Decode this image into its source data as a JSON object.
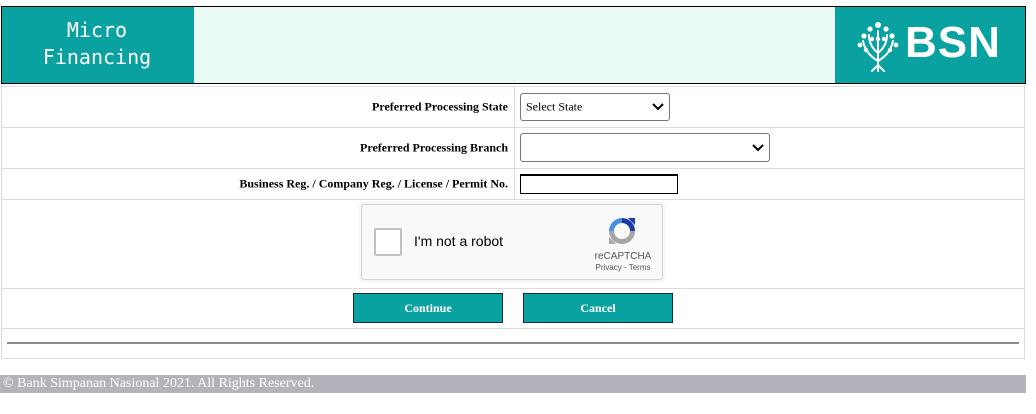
{
  "header": {
    "app_title_line1": "Micro",
    "app_title_line2": "Financing",
    "brand_name": "BSN",
    "logo_icon": "tree-icon",
    "accent_color": "#0aa1a1"
  },
  "form": {
    "state_label": "Preferred Processing State",
    "state_value": "Select State",
    "branch_label": "Preferred Processing Branch",
    "branch_value": "",
    "regno_label": "Business Reg. / Company Reg. / License / Permit No.",
    "regno_value": ""
  },
  "captcha": {
    "label": "I'm not a robot",
    "brand": "reCAPTCHA",
    "links": "Privacy - Terms",
    "checked": false
  },
  "buttons": {
    "continue_label": "Continue",
    "cancel_label": "Cancel"
  },
  "footer": {
    "copyright": "© Bank Simpanan Nasional 2021. All Rights Reserved."
  }
}
